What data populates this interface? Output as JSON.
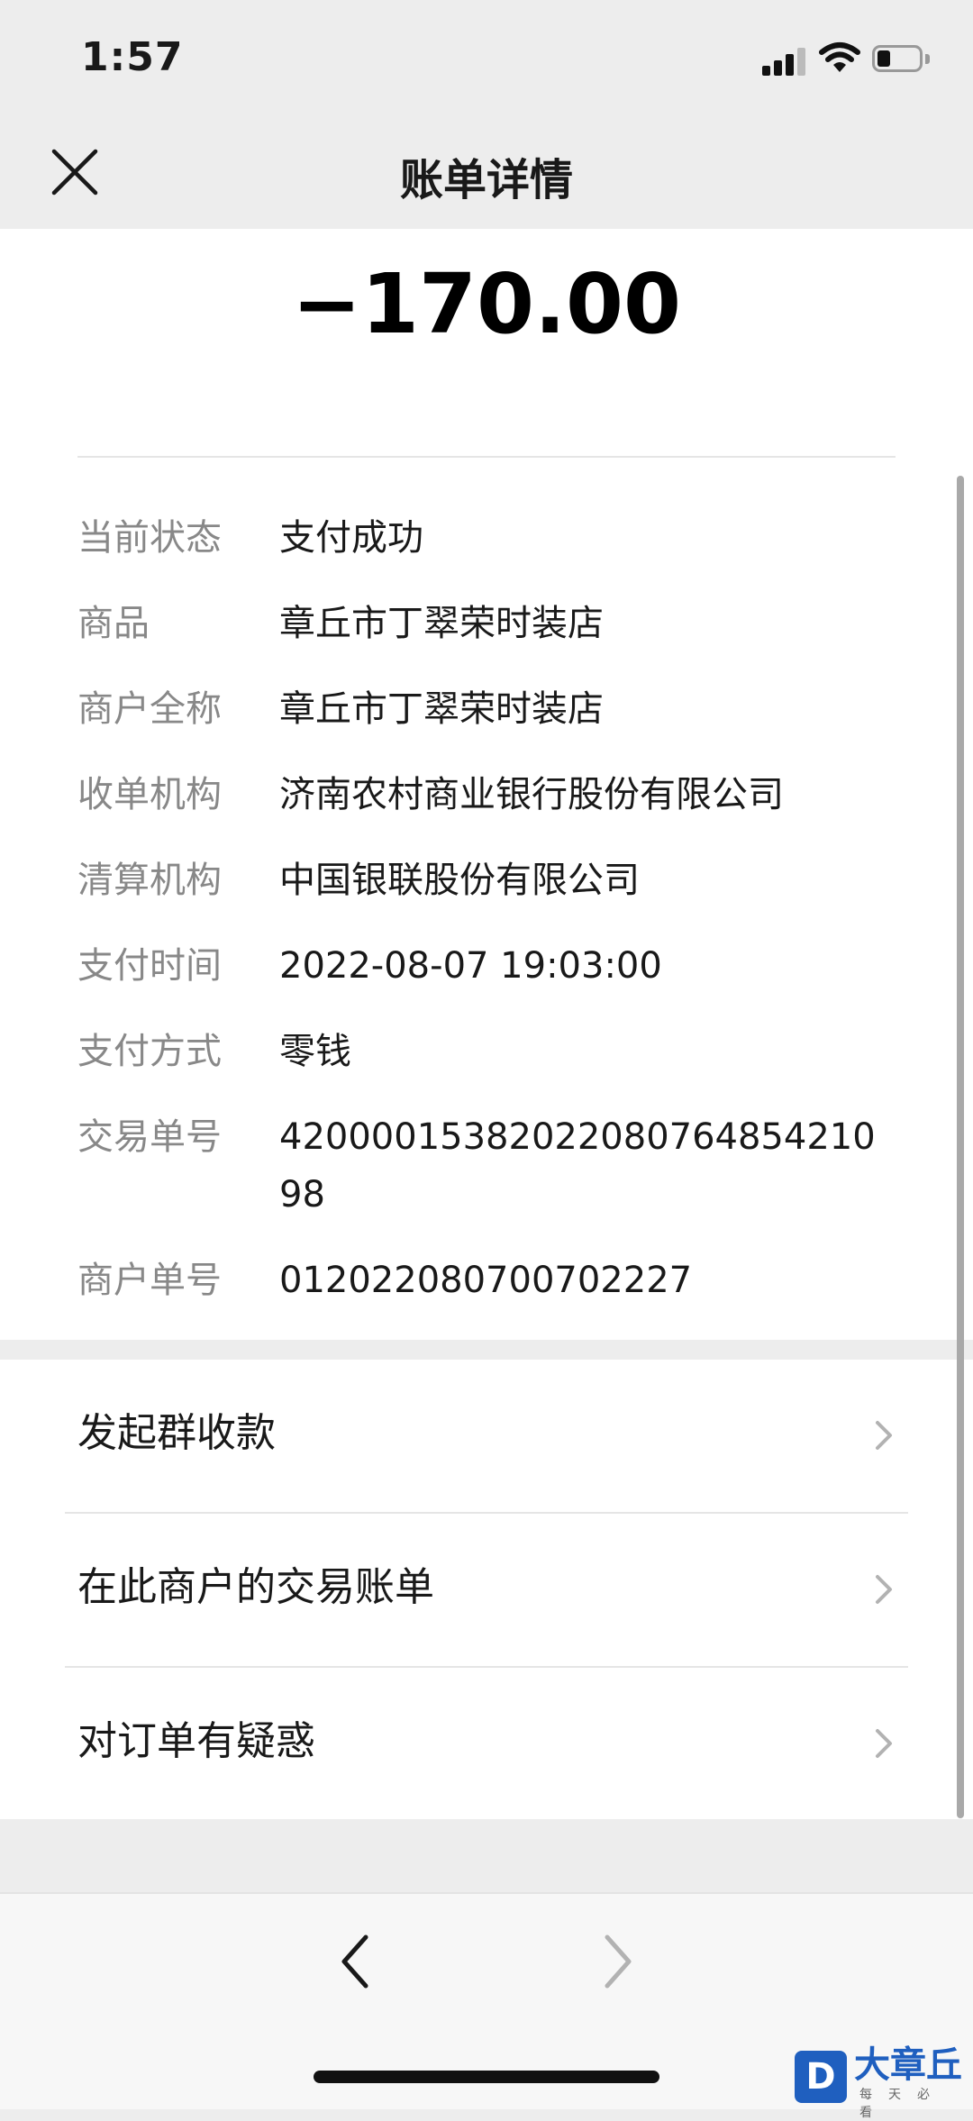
{
  "status_bar": {
    "time": "1:57"
  },
  "nav": {
    "title": "账单详情"
  },
  "bill": {
    "amount": "−170.00"
  },
  "details": [
    {
      "label": "当前状态",
      "value": "支付成功"
    },
    {
      "label": "商品",
      "value": "章丘市丁翠荣时装店"
    },
    {
      "label": "商户全称",
      "value": "章丘市丁翠荣时装店"
    },
    {
      "label": "收单机构",
      "value": "济南农村商业银行股份有限公司"
    },
    {
      "label": "清算机构",
      "value": "中国银联股份有限公司"
    },
    {
      "label": "支付时间",
      "value": "2022-08-07 19:03:00"
    },
    {
      "label": "支付方式",
      "value": "零钱"
    },
    {
      "label": "交易单号",
      "value": "4200001538202208076485421098"
    },
    {
      "label": "商户单号",
      "value": "012022080700702227"
    }
  ],
  "actions": [
    {
      "label": "发起群收款"
    },
    {
      "label": "在此商户的交易账单"
    },
    {
      "label": "对订单有疑惑"
    }
  ],
  "watermark": {
    "logo_letter": "D",
    "name": "大章丘",
    "tagline": "每天必看"
  },
  "colors": {
    "background": "#ededed",
    "card": "#ffffff",
    "label_gray": "#888888",
    "watermark_blue": "#1f5fbf"
  }
}
